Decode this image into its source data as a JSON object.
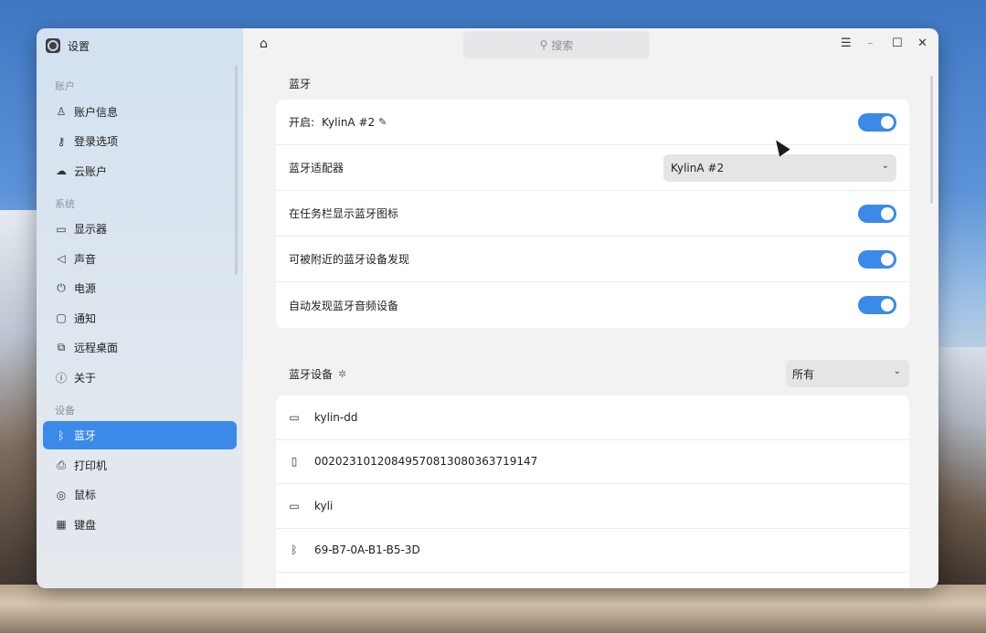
{
  "window": {
    "title": "设置"
  },
  "sidebar": {
    "sections": [
      {
        "label": "账户",
        "items": [
          {
            "label": "账户信息",
            "icon": "user-icon",
            "glyph": "♙"
          },
          {
            "label": "登录选项",
            "icon": "key-icon",
            "glyph": "⚷"
          },
          {
            "label": "云账户",
            "icon": "cloud-account-icon",
            "glyph": "☁"
          }
        ]
      },
      {
        "label": "系统",
        "items": [
          {
            "label": "显示器",
            "icon": "monitor-icon",
            "glyph": "▭"
          },
          {
            "label": "声音",
            "icon": "speaker-icon",
            "glyph": "◁"
          },
          {
            "label": "电源",
            "icon": "power-icon",
            "glyph": "⏻"
          },
          {
            "label": "通知",
            "icon": "notification-icon",
            "glyph": "▢"
          },
          {
            "label": "远程桌面",
            "icon": "remote-desktop-icon",
            "glyph": "⧉"
          },
          {
            "label": "关于",
            "icon": "info-icon",
            "glyph": "ⓘ"
          }
        ]
      },
      {
        "label": "设备",
        "items": [
          {
            "label": "蓝牙",
            "icon": "bluetooth-icon",
            "glyph": "ᛒ",
            "active": true
          },
          {
            "label": "打印机",
            "icon": "printer-icon",
            "glyph": "⎙"
          },
          {
            "label": "鼠标",
            "icon": "mouse-icon",
            "glyph": "◎"
          },
          {
            "label": "键盘",
            "icon": "keyboard-icon",
            "glyph": "▦"
          }
        ]
      }
    ]
  },
  "titlebar": {
    "search_placeholder": "搜索"
  },
  "bluetooth": {
    "group_title": "蓝牙",
    "enable_label": "开启:",
    "device_name": "KylinA #2",
    "adapter_label": "蓝牙适配器",
    "adapter_value": "KylinA #2",
    "taskbar_icon_label": "在任务栏显示蓝牙图标",
    "discoverable_label": "可被附近的蓝牙设备发现",
    "auto_audio_label": "自动发现蓝牙音频设备",
    "toggles": {
      "enabled": true,
      "taskbar_icon": true,
      "discoverable": true,
      "auto_audio": true
    }
  },
  "devices": {
    "title": "蓝牙设备",
    "filter_value": "所有",
    "items": [
      {
        "name": "kylin-dd",
        "icon": "computer-icon",
        "glyph": "▭"
      },
      {
        "name": "00202310120849570813080363719147",
        "icon": "phone-icon",
        "glyph": "▯"
      },
      {
        "name": "kyli",
        "icon": "computer-icon",
        "glyph": "▭"
      },
      {
        "name": "69-B7-0A-B1-B5-3D",
        "icon": "bluetooth-icon",
        "glyph": "ᛒ"
      }
    ]
  },
  "colors": {
    "accent": "#3b89e9"
  }
}
